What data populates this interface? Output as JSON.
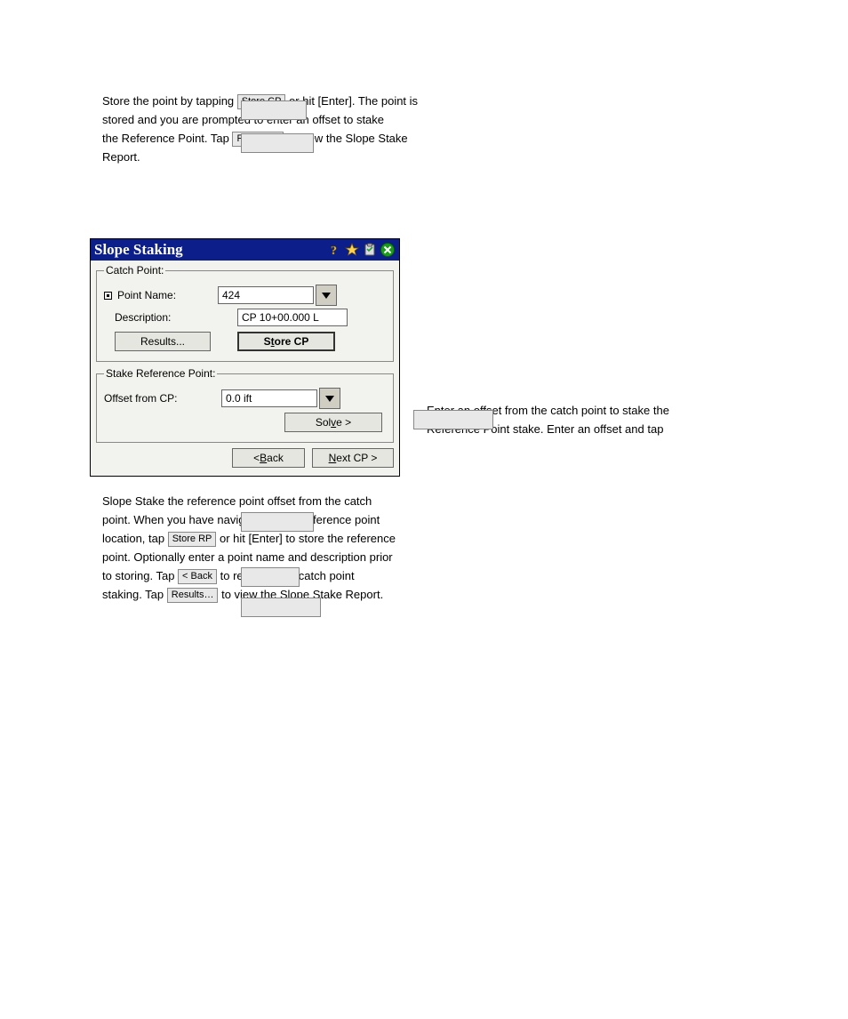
{
  "doc": {
    "line1a": "Store the point by tapping ",
    "line1_btn": "Store CP",
    "line1b": " or hit [Enter]. The point is",
    "line1c": "stored and you are prompted to enter an offset to stake",
    "line1d": "the Reference Point. Tap ",
    "line1d_btn": "Results…",
    "line1e": " to view the Slope Stake",
    "line1f": "Report.",
    "line2a": "Enter an offset from the catch point to stake the",
    "line2b": "Reference Point stake. Enter an offset and tap ",
    "line2_btn": "Solve >",
    "line3a": "Slope Stake the reference point offset from the catch",
    "line3b": "point. When you have navigated to the reference point",
    "line3c": "location, tap ",
    "line3c_btn": "Store RP",
    "line3d": " or hit [Enter] to store the reference",
    "line3e": "point. Optionally enter a point name and description prior",
    "line3f": "to storing. Tap ",
    "line3f_btn": "< Back",
    "line3g": " to return to the catch point",
    "line3h": "staking. Tap ",
    "line3h_btn": "Results…",
    "line3i": " to view the Slope Stake Report."
  },
  "win": {
    "title": "Slope Staking",
    "group_catch": "Catch Point:",
    "pointname_label": "Point Name:",
    "pointname_value": "424",
    "description_label": "Description:",
    "description_value": "CP 10+00.000 L",
    "results_btn": "Results...",
    "storecp_btn_pre": "S",
    "storecp_btn_under": "t",
    "storecp_btn_post": "ore CP",
    "group_ref": "Stake Reference Point:",
    "offset_label": "Offset from CP:",
    "offset_value": "0.0 ift",
    "solve_btn_pre": "Sol",
    "solve_btn_under": "v",
    "solve_btn_post": "e >",
    "back_btn_pre": "< ",
    "back_btn_under": "B",
    "back_btn_post": "ack",
    "next_btn_pre": "",
    "next_btn_under": "N",
    "next_btn_post": "ext CP >"
  }
}
